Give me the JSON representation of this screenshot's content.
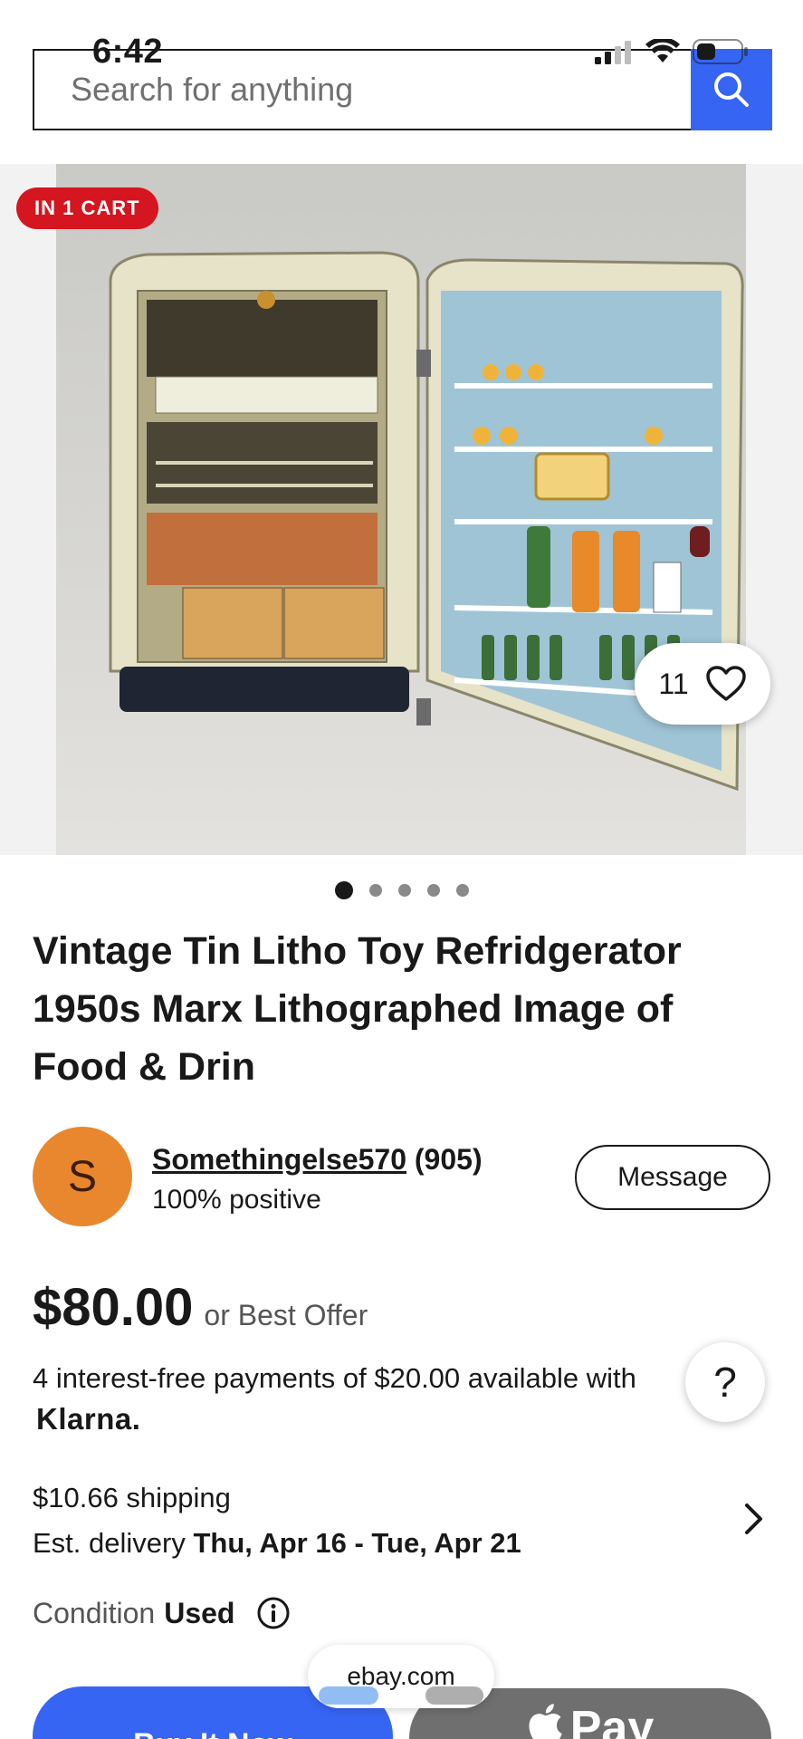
{
  "status_bar": {
    "time": "6:42"
  },
  "search": {
    "placeholder": "Search for anything"
  },
  "hero": {
    "cart_badge": "IN 1 CART",
    "watch_count": "11",
    "dots_total": 5,
    "dots_active": 1
  },
  "item": {
    "title": "Vintage Tin Litho Toy Refridgerator 1950s Marx Lithographed Image of Food & Drin"
  },
  "seller": {
    "avatar_letter": "S",
    "name": "Somethingelse570",
    "feedback_count": "(905)",
    "positive": "100% positive",
    "message_label": "Message"
  },
  "price": {
    "amount": "$80.00",
    "best_offer": "or Best Offer"
  },
  "klarna": {
    "text": "4 interest-free payments of $20.00 available with",
    "logo": "Klarna."
  },
  "help": {
    "label": "?"
  },
  "shipping": {
    "cost": "$10.66 shipping",
    "delivery_label": "Est. delivery",
    "delivery_dates": "Thu, Apr 16 - Tue, Apr 21"
  },
  "condition": {
    "label": "Condition",
    "value": "Used"
  },
  "browser": {
    "url": "ebay.com"
  },
  "actions": {
    "buy_now": "Buy It Now",
    "apple_pay": "Pay"
  },
  "colors": {
    "accent_blue": "#3665f3",
    "badge_red": "#d5151f",
    "avatar_orange": "#e8872d"
  }
}
